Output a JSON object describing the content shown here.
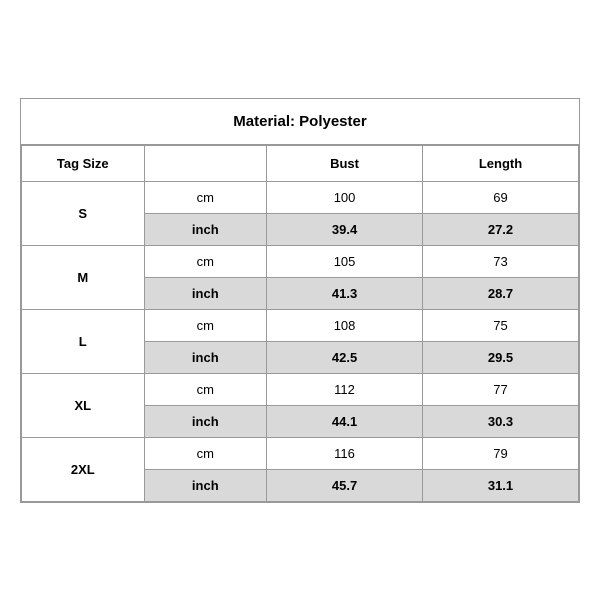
{
  "title": "Material: Polyester",
  "headers": [
    "Tag Size",
    "",
    "Bust",
    "Length"
  ],
  "sizes": [
    {
      "tag": "S",
      "cm": {
        "unit": "cm",
        "bust": "100",
        "length": "69"
      },
      "inch": {
        "unit": "inch",
        "bust": "39.4",
        "length": "27.2"
      }
    },
    {
      "tag": "M",
      "cm": {
        "unit": "cm",
        "bust": "105",
        "length": "73"
      },
      "inch": {
        "unit": "inch",
        "bust": "41.3",
        "length": "28.7"
      }
    },
    {
      "tag": "L",
      "cm": {
        "unit": "cm",
        "bust": "108",
        "length": "75"
      },
      "inch": {
        "unit": "inch",
        "bust": "42.5",
        "length": "29.5"
      }
    },
    {
      "tag": "XL",
      "cm": {
        "unit": "cm",
        "bust": "112",
        "length": "77"
      },
      "inch": {
        "unit": "inch",
        "bust": "44.1",
        "length": "30.3"
      }
    },
    {
      "tag": "2XL",
      "cm": {
        "unit": "cm",
        "bust": "116",
        "length": "79"
      },
      "inch": {
        "unit": "inch",
        "bust": "45.7",
        "length": "31.1"
      }
    }
  ]
}
